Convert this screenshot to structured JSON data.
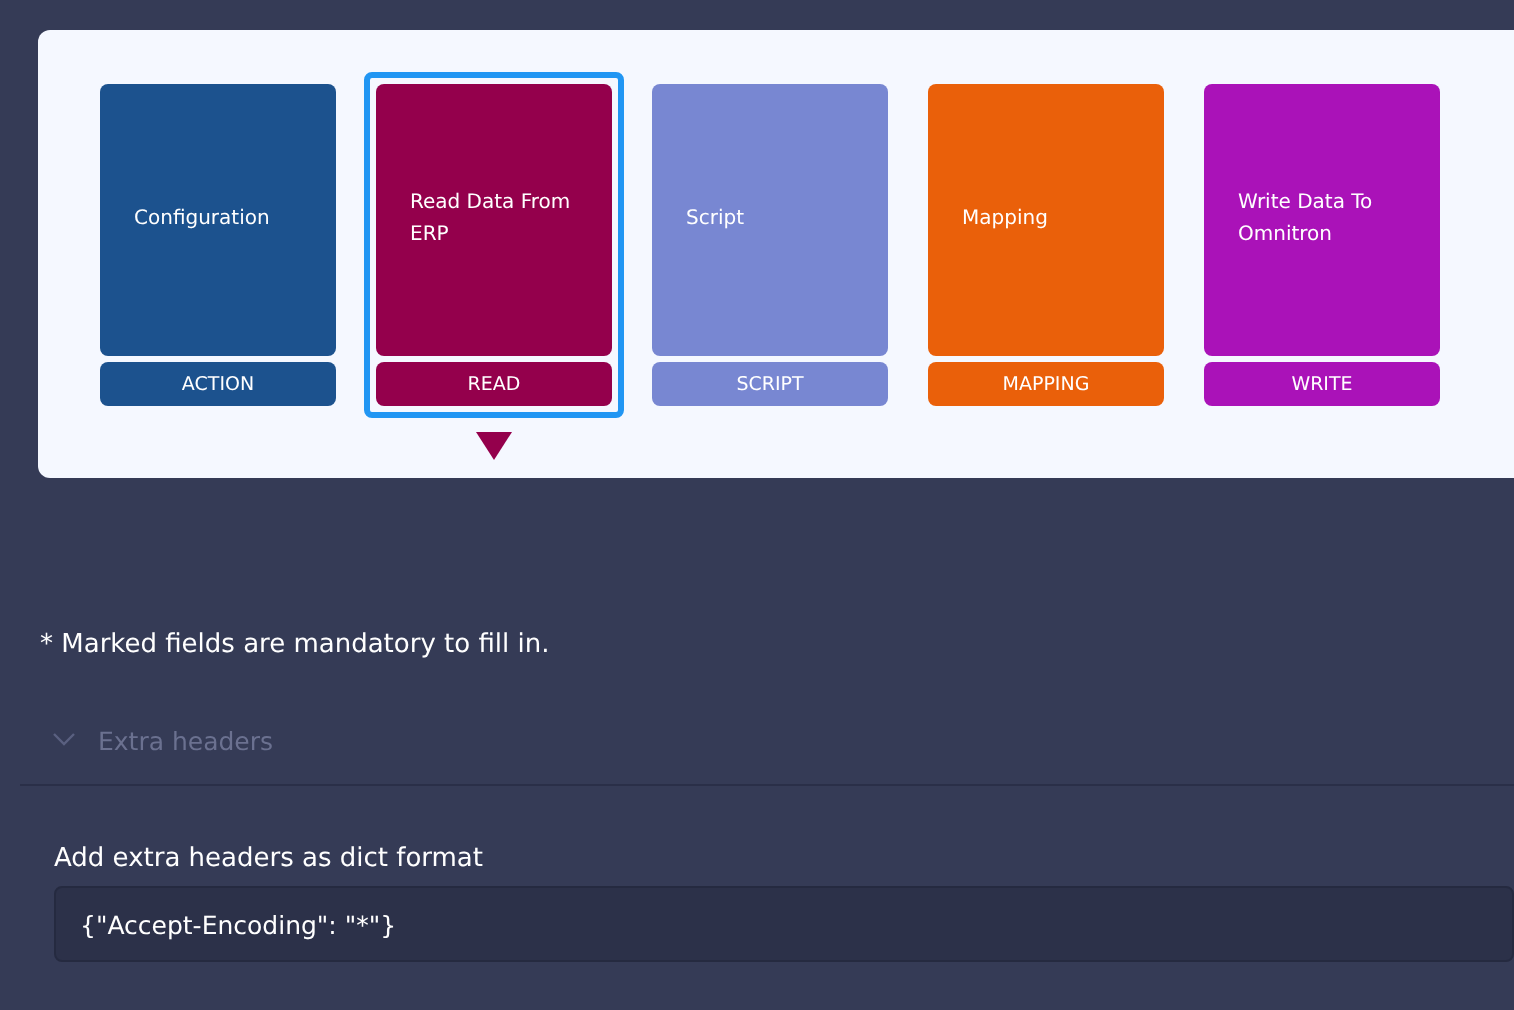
{
  "steps": [
    {
      "title": "Configuration",
      "tag": "ACTION",
      "color": "#1c528e",
      "selected": false
    },
    {
      "title": "Read Data From ERP",
      "tag": "READ",
      "color": "#94004c",
      "selected": true
    },
    {
      "title": "Script",
      "tag": "SCRIPT",
      "color": "#7887d2",
      "selected": false
    },
    {
      "title": "Mapping",
      "tag": "MAPPING",
      "color": "#ea600a",
      "selected": false
    },
    {
      "title": "Write Data To Omnitron",
      "tag": "WRITE",
      "color": "#aa12b8",
      "selected": false
    }
  ],
  "note": "* Marked fields are mandatory to fill in.",
  "section": {
    "title": "Extra headers",
    "expanded": true
  },
  "field": {
    "label": "Add extra headers as dict format",
    "value": "{\"Accept-Encoding\": \"*\"}"
  }
}
